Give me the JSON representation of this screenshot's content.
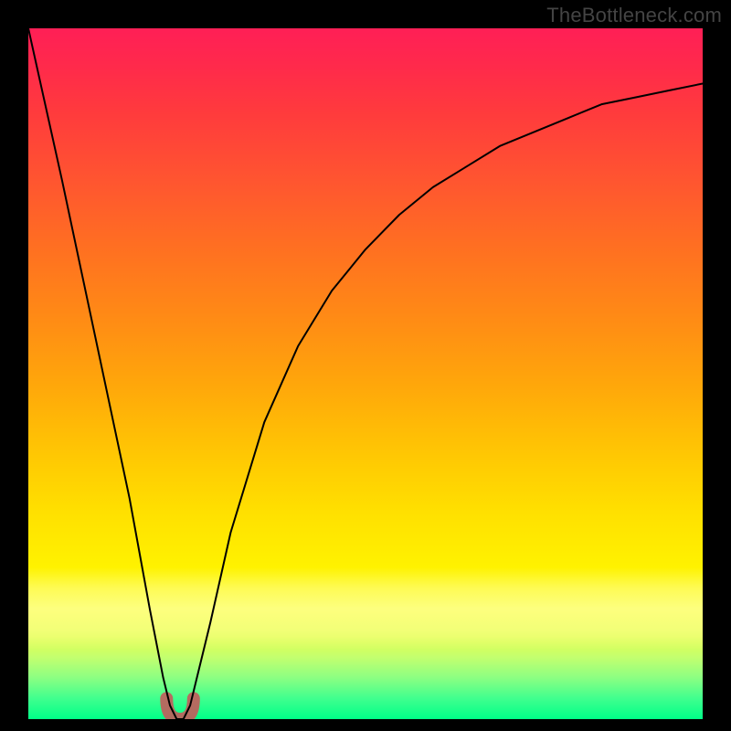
{
  "watermark": "TheBottleneck.com",
  "colors": {
    "background": "#000000",
    "gradient_top": "#ff1f56",
    "gradient_mid": "#ffe000",
    "gradient_bottom": "#00ff88",
    "curve_stroke": "#000000",
    "valley_highlight": "#c35b5b"
  },
  "chart_data": {
    "type": "line",
    "title": "",
    "xlabel": "",
    "ylabel": "",
    "xlim": [
      0,
      100
    ],
    "ylim": [
      0,
      100
    ],
    "series": [
      {
        "name": "bottleneck-curve",
        "x": [
          0,
          5,
          10,
          15,
          18,
          20,
          21,
          22,
          23,
          24,
          25,
          27,
          30,
          35,
          40,
          45,
          50,
          55,
          60,
          65,
          70,
          75,
          80,
          85,
          90,
          95,
          100
        ],
        "y": [
          100,
          78,
          55,
          32,
          16,
          6,
          2,
          0,
          0,
          2,
          6,
          14,
          27,
          43,
          54,
          62,
          68,
          73,
          77,
          80,
          83,
          85,
          87,
          89,
          90,
          91,
          92
        ]
      }
    ],
    "annotations": [
      {
        "name": "minimum-highlight",
        "x_range": [
          20.5,
          24.5
        ],
        "y_range": [
          0,
          3
        ],
        "note": "valley of curve highlighted"
      }
    ],
    "background_gradient_stops": [
      {
        "pos": 0.0,
        "color": "#ff1f56"
      },
      {
        "pos": 0.3,
        "color": "#ff7021"
      },
      {
        "pos": 0.6,
        "color": "#ffc803"
      },
      {
        "pos": 0.8,
        "color": "#fff200"
      },
      {
        "pos": 0.95,
        "color": "#8cff82"
      },
      {
        "pos": 1.0,
        "color": "#00ff88"
      }
    ]
  }
}
